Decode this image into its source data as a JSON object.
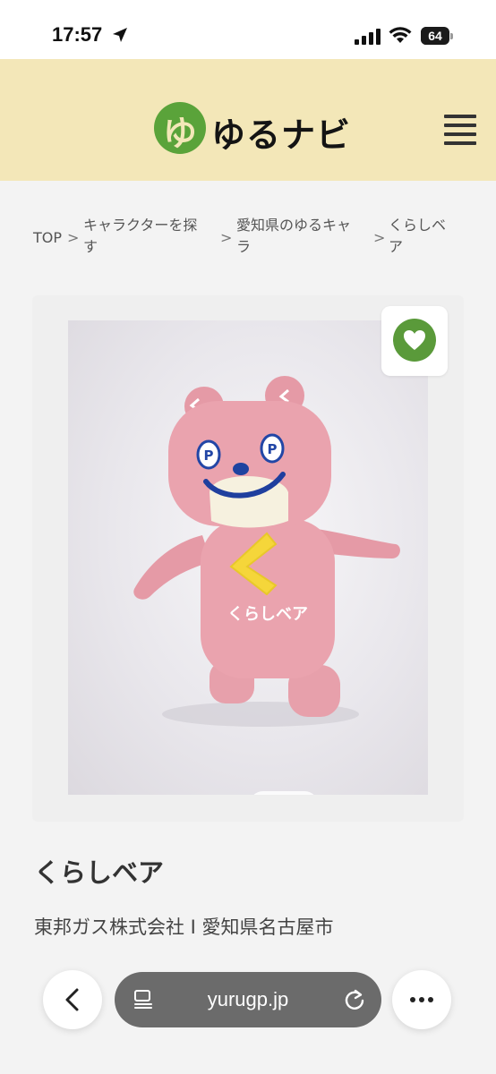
{
  "status_bar": {
    "time": "17:57",
    "battery_percent": 64,
    "battery_label": "64"
  },
  "header": {
    "logo_mark": "ゆ",
    "logo_text": "ゆるナビ",
    "brand_color": "#5aa33a",
    "header_bg": "#f3e7b8"
  },
  "breadcrumb": {
    "items": [
      {
        "line1": "TOP",
        "line2": ""
      },
      {
        "line1": "キャラクターを探",
        "line2": "す"
      },
      {
        "line1": "愛知県のゆるキャ",
        "line2": "ラ"
      },
      {
        "line1": "くらしベ",
        "line2": "ア"
      }
    ],
    "separator": ">"
  },
  "gallery": {
    "image_count": 3,
    "active_index": 2,
    "favorite_icon": "heart-icon",
    "mascot_chest_text": "くらしベア",
    "mascot_eye_letter": "P"
  },
  "character": {
    "name": "くらしベア",
    "org_line": "東邦ガス株式会社 I 愛知県名古屋市"
  },
  "browser": {
    "url": "yurugp.jp",
    "back_icon": "chevron-left-icon",
    "reader_icon": "reader-icon",
    "reload_icon": "reload-icon",
    "more_icon": "more-icon"
  }
}
